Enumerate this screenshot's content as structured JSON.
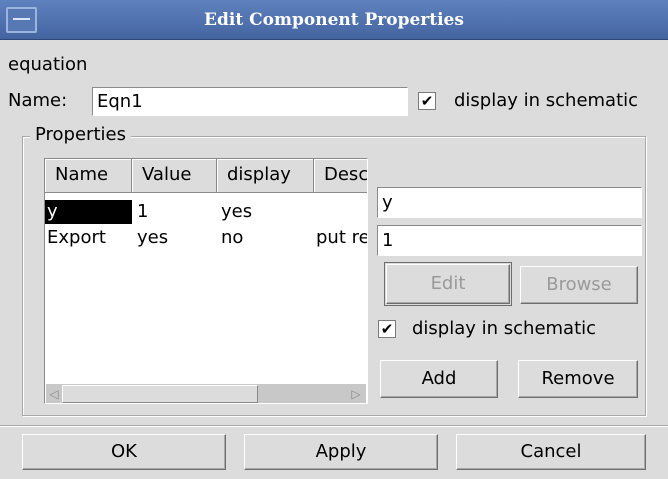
{
  "window": {
    "title": "Edit Component Properties"
  },
  "component": {
    "type_label": "equation"
  },
  "name_row": {
    "label": "Name:",
    "value": "Eqn1",
    "display_checked": true,
    "display_label": "display in schematic"
  },
  "properties": {
    "group_title": "Properties",
    "columns": [
      "Name",
      "Value",
      "display",
      "Desc"
    ],
    "rows": [
      {
        "name": "y",
        "value": "1",
        "display": "yes",
        "desc": ""
      },
      {
        "name": "Export",
        "value": "yes",
        "display": "no",
        "desc": "put re"
      }
    ],
    "selected_row": 0,
    "edit_name_value": "y",
    "edit_value_value": "1",
    "edit_label": "Edit",
    "browse_label": "Browse",
    "display_checked": true,
    "display_label": "display in schematic",
    "add_label": "Add",
    "remove_label": "Remove"
  },
  "buttons": {
    "ok": "OK",
    "apply": "Apply",
    "cancel": "Cancel"
  },
  "icons": {
    "window_menu": "window-menu-icon",
    "check": "check-icon",
    "scroll_left": "arrow-left-icon",
    "scroll_right": "arrow-right-icon"
  },
  "colors": {
    "titlebar": "#5275b2",
    "background": "#dcdcdc",
    "selection": "#000000"
  }
}
